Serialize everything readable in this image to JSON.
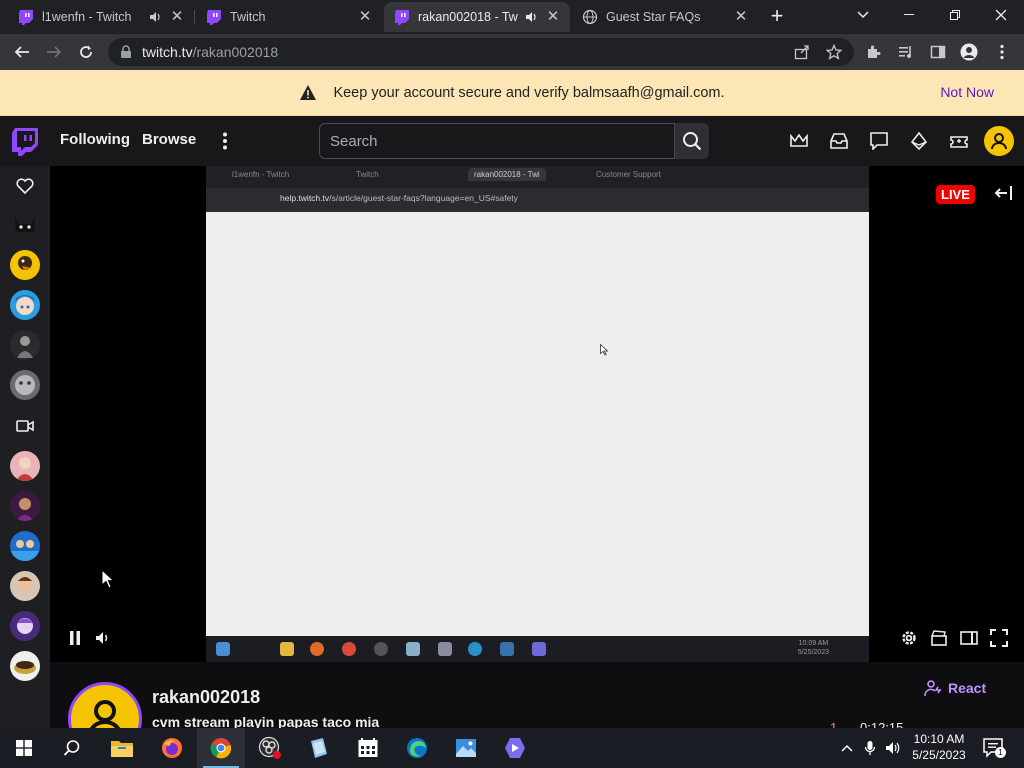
{
  "browser": {
    "tabs": [
      {
        "title": "l1wenfn - Twitch",
        "audio": true
      },
      {
        "title": "Twitch",
        "audio": false
      },
      {
        "title": "rakan002018 - Twi",
        "audio": true
      },
      {
        "title": "Guest Star FAQs",
        "audio": false
      }
    ],
    "url": {
      "host": "twitch.tv",
      "path": "/rakan002018"
    }
  },
  "banner": {
    "message": "Keep your account secure and verify balmsaafh@gmail.com.",
    "dismiss_label": "Not Now"
  },
  "twitch_nav": {
    "following_label": "Following",
    "browse_label": "Browse",
    "search_placeholder": "Search"
  },
  "player": {
    "live_label": "LIVE",
    "mirrored_screen": {
      "tabs": [
        "l1wenfn - Twitch",
        "Twitch",
        "rakan002018 - Twi",
        "Customer Support"
      ],
      "url": {
        "host": "help.twitch.tv",
        "path": "/s/article/guest-star-faqs?language=en_US#safety"
      },
      "clock_time": "10:09 AM",
      "clock_date": "5/25/2023"
    }
  },
  "channel": {
    "name": "rakan002018",
    "stream_title": "cvm stream playin papas taco mia",
    "react_label": "React",
    "viewer_count": "1",
    "uptime": "0:12:15"
  },
  "taskbar": {
    "time": "10:10 AM",
    "date": "5/25/2023",
    "notification_count": "1"
  },
  "colors": {
    "twitch_purple": "#9147ff",
    "banner_bg": "#fde6b6",
    "live_red": "#eb0400",
    "link_purple": "#5c16c5"
  }
}
